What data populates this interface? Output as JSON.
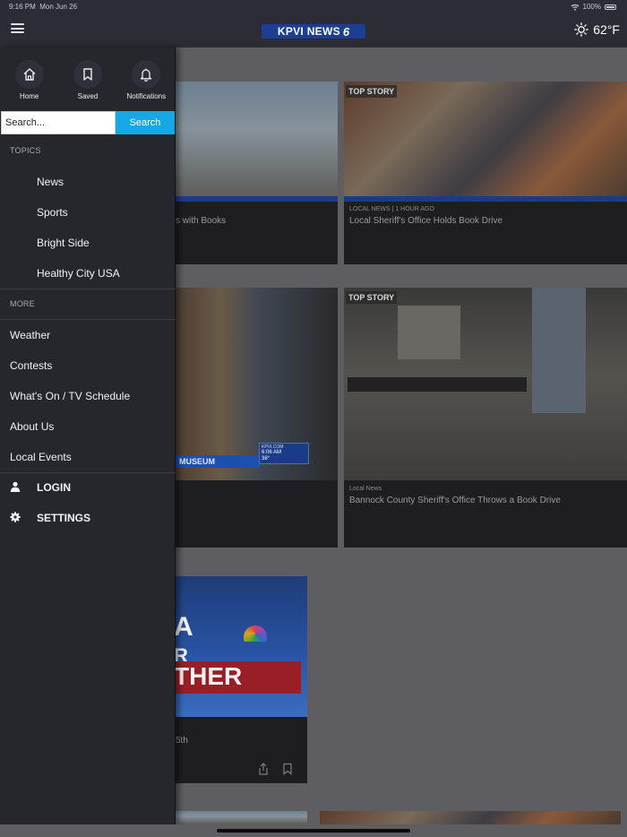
{
  "status_bar": {
    "time": "9:16 PM",
    "date": "Mon Jun 26",
    "battery": "100%"
  },
  "header": {
    "logo_text": "KPVI NEWS",
    "logo_number": "6",
    "temperature": "62°F",
    "weather_icon": "sun-icon",
    "menu_icon": "hamburger-menu-icon"
  },
  "drawer": {
    "quick_actions": [
      {
        "label": "Home",
        "icon": "home-icon"
      },
      {
        "label": "Saved",
        "icon": "bookmark-icon"
      },
      {
        "label": "Notifications",
        "icon": "bell-icon"
      }
    ],
    "search": {
      "placeholder": "Search...",
      "button_label": "Search"
    },
    "topics_header": "TOPICS",
    "topics": [
      "News",
      "Sports",
      "Bright Side",
      "Healthy City USA"
    ],
    "more_header": "MORE",
    "more_items": [
      "Weather",
      "Contests",
      "What's On / TV Schedule",
      "About Us",
      "Local Events"
    ],
    "login_label": "LOGIN",
    "settings_label": "SETTINGS"
  },
  "feed": {
    "card1": {
      "headline_fragment": "s with Books"
    },
    "card2": {
      "tag": "TOP STORY",
      "meta": "LOCAL NEWS | 1 HOUR AGO",
      "headline": "Local Sheriff's Office Holds Book Drive"
    },
    "card3": {
      "overlay_text": "MUSEUM",
      "station_url": "KPVI.COM",
      "station_time": "6:06 AM",
      "station_temp": "38°"
    },
    "card4": {
      "tag": "TOP STORY",
      "meta": "Local News",
      "headline": "Bannock County Sheriff's Office Throws a Book Drive"
    },
    "card5": {
      "headline_fragment": "5th",
      "wx_line1": "A",
      "wx_line2": "R",
      "wx_line3": "THER"
    }
  },
  "colors": {
    "accent": "#14a8e6",
    "drawer_bg": "#26262d",
    "header_bg": "#2c2c34",
    "logo_bg": "#1c3f93"
  }
}
